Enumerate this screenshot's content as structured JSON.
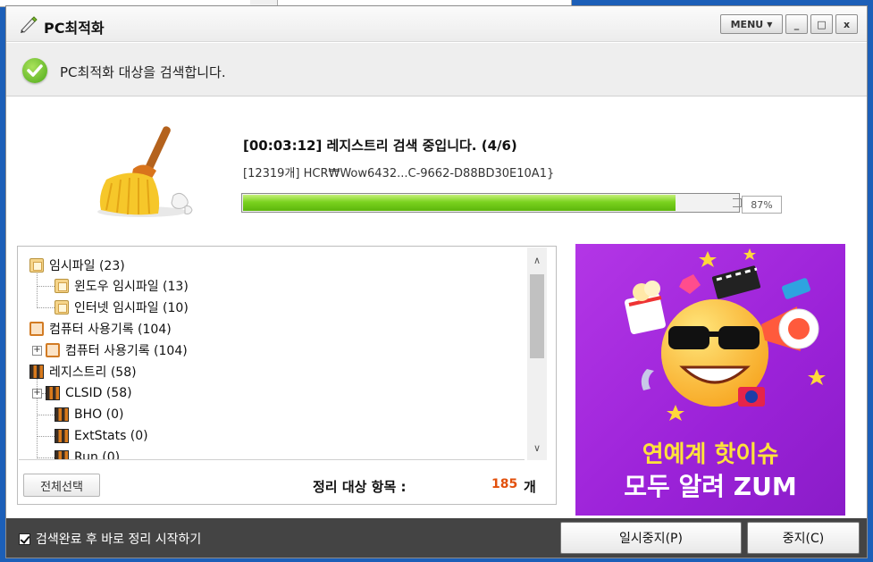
{
  "window": {
    "title": "PC최적화",
    "menu_label": "MENU",
    "minimize_glyph": "_",
    "maximize_glyph": "□",
    "close_glyph": "x"
  },
  "status": {
    "text": "PC최적화 대상을 검색합니다."
  },
  "scan": {
    "title": "[00:03:12] 레지스트리 검색 중입니다. (4/6)",
    "current_item": "[12319개] HCR₩Wow6432...C-9662-D88BD30E10A1}",
    "progress_percent": 87,
    "progress_label": "87%"
  },
  "tree": {
    "items": [
      {
        "label": "임시파일 (23)",
        "icon": "temp-folder-icon"
      },
      {
        "label": "윈도우 임시파일 (13)",
        "icon": "temp-folder-icon"
      },
      {
        "label": "인터넷 임시파일 (10)",
        "icon": "temp-folder-icon"
      },
      {
        "label": "컴퓨터 사용기록 (104)",
        "icon": "record-icon"
      },
      {
        "label": "컴퓨터 사용기록 (104)",
        "icon": "record-icon"
      },
      {
        "label": "레지스트리 (58)",
        "icon": "registry-icon"
      },
      {
        "label": "CLSID (58)",
        "icon": "registry-icon"
      },
      {
        "label": "BHO (0)",
        "icon": "registry-icon"
      },
      {
        "label": "ExtStats (0)",
        "icon": "registry-icon"
      },
      {
        "label": "Run (0)",
        "icon": "registry-icon"
      }
    ],
    "expand_glyph": "+"
  },
  "summary": {
    "select_all_label": "전체선택",
    "total_label": "정리 대상 항목 :",
    "total_count": "185",
    "total_unit": "개"
  },
  "ad": {
    "line1": "연예계 핫이슈",
    "line2": "모두 알려 ZUM",
    "colors": {
      "background": "#a22ee0",
      "headline": "#ffe23a"
    }
  },
  "footer": {
    "auto_clean_label": "검색완료 후 바로 정리 시작하기",
    "auto_clean_checked": true,
    "pause_label": "일시중지(P)",
    "stop_label": "중지(C)"
  },
  "colors": {
    "progress": "#6cc61a",
    "count_accent": "#e2500c",
    "footer_bg": "#444444"
  }
}
